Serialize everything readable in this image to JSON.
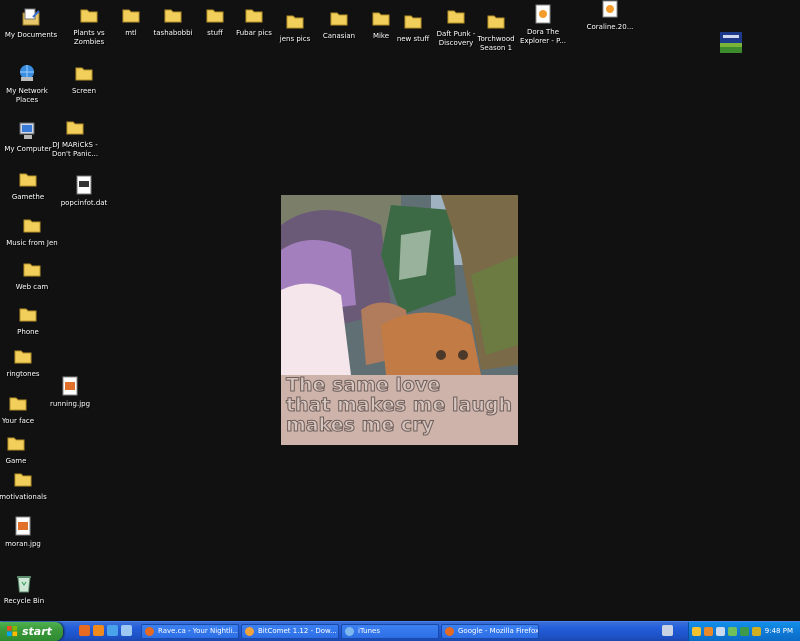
{
  "desktop": {
    "icons": [
      {
        "label": "My Documents",
        "type": "mydocs-icon"
      },
      {
        "label": "My Network Places",
        "type": "network-icon"
      },
      {
        "label": "My Computer",
        "type": "computer-icon"
      },
      {
        "label": "Gamethe",
        "type": "folder-icon"
      },
      {
        "label": "Music from Jen",
        "type": "folder-icon"
      },
      {
        "label": "Web cam",
        "type": "folder-icon"
      },
      {
        "label": "Phone",
        "type": "folder-icon"
      },
      {
        "label": "ringtones",
        "type": "folder-icon"
      },
      {
        "label": "Your face",
        "type": "folder-icon"
      },
      {
        "label": "Game",
        "type": "folder-icon"
      },
      {
        "label": "motivationals",
        "type": "folder-icon"
      },
      {
        "label": "moran.jpg",
        "type": "image-file-icon"
      },
      {
        "label": "Recycle Bin",
        "type": "recycle-bin-icon"
      },
      {
        "label": "Plants vs Zombies",
        "type": "folder-icon"
      },
      {
        "label": "Screen",
        "type": "folder-icon"
      },
      {
        "label": "DJ MARiCkS - Don't Panic...",
        "type": "folder-icon"
      },
      {
        "label": "popcinfot.dat",
        "type": "file-icon"
      },
      {
        "label": "running.jpg",
        "type": "image-file-icon"
      },
      {
        "label": "mtl",
        "type": "folder-icon"
      },
      {
        "label": "tashabobbi",
        "type": "folder-icon"
      },
      {
        "label": "stuff",
        "type": "folder-icon"
      },
      {
        "label": "Fubar pics",
        "type": "folder-icon"
      },
      {
        "label": "jens pics",
        "type": "folder-icon"
      },
      {
        "label": "Canasian",
        "type": "folder-icon"
      },
      {
        "label": "Mike",
        "type": "folder-icon"
      },
      {
        "label": "new stuff",
        "type": "folder-icon"
      },
      {
        "label": "Daft Punk - Discovery",
        "type": "folder-icon"
      },
      {
        "label": "Torchwood Season 1",
        "type": "folder-icon"
      },
      {
        "label": "Dora The Explorer - P...",
        "type": "video-file-icon"
      },
      {
        "label": "Coraline.20...",
        "type": "video-file-icon"
      }
    ],
    "wallpaper": {
      "caption_lines": [
        "The same love",
        "that makes me laugh",
        "makes me cry"
      ]
    }
  },
  "taskbar": {
    "start_label": "start",
    "tasks": [
      {
        "label": "Rave.ca - Your Nightli...",
        "icon": "firefox-icon"
      },
      {
        "label": "BitComet 1.12 - Dow...",
        "icon": "bitcomet-icon"
      },
      {
        "label": "iTunes",
        "icon": "itunes-icon"
      },
      {
        "label": "Google - Mozilla Firefox",
        "icon": "firefox-icon"
      }
    ],
    "clock": "9:48 PM",
    "colors": {
      "taskbar": "#245edb",
      "start": "#3c9a3c",
      "tray": "#0f7ad8"
    }
  }
}
